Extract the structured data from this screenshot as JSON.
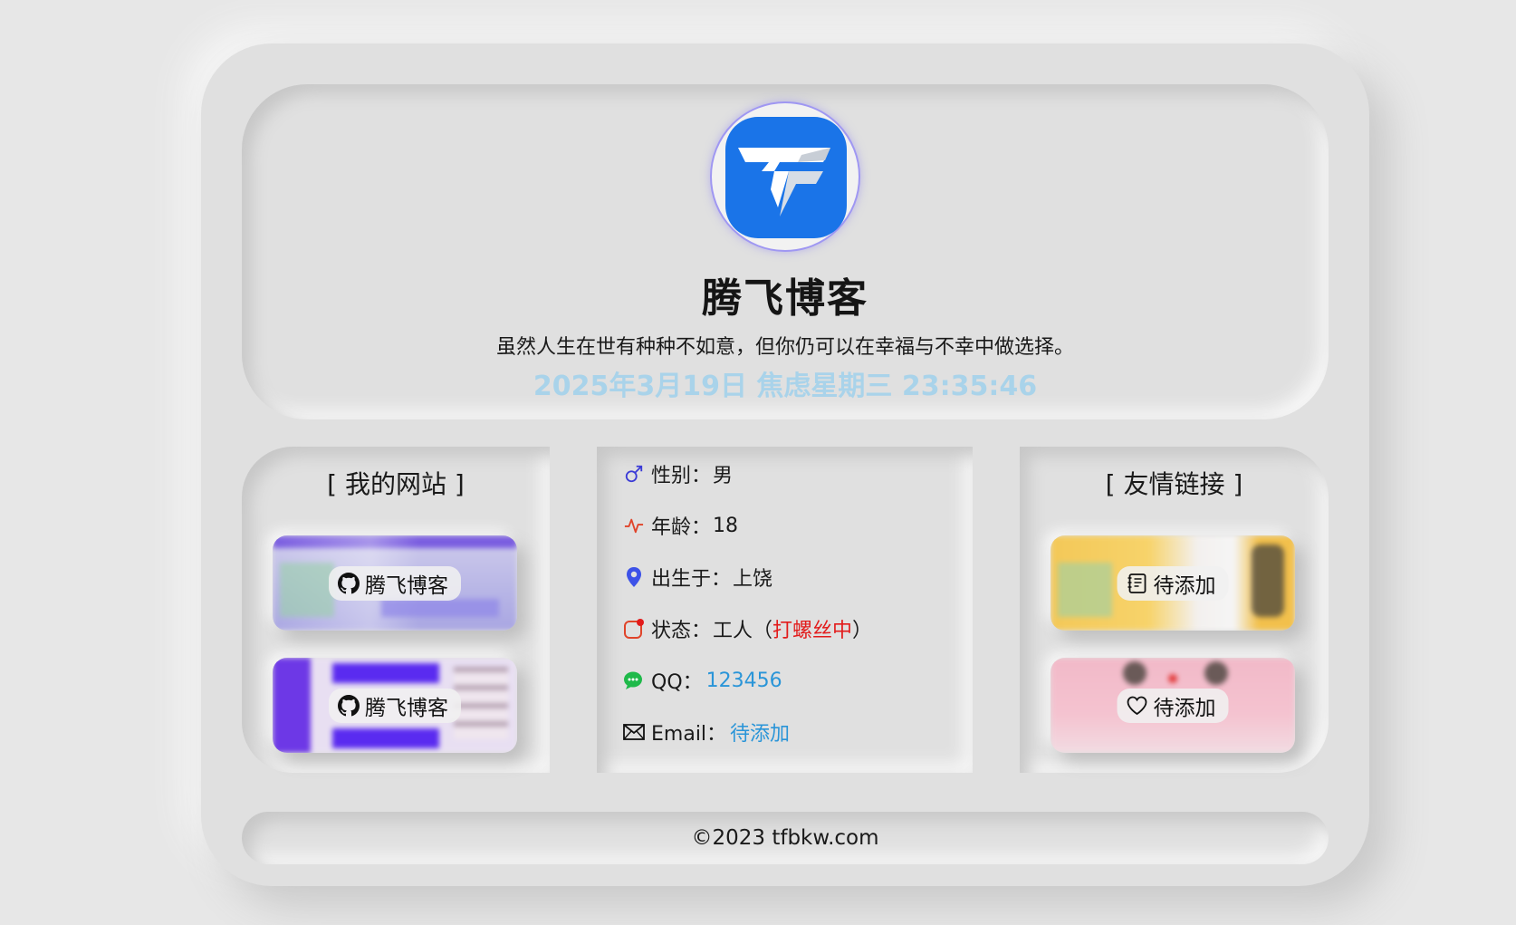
{
  "header": {
    "title": "腾飞博客",
    "motto": "虽然人生在世有种种不如意，但你仍可以在幸福与不幸中做选择。",
    "clock": "2025年3月19日 焦虑星期三 23:35:46"
  },
  "my_sites": {
    "heading": "[ 我的网站 ]",
    "items": [
      {
        "label": "腾飞博客",
        "icon": "github-icon"
      },
      {
        "label": "腾飞博客",
        "icon": "github-icon"
      }
    ]
  },
  "profile": {
    "gender_label": "性别：",
    "gender_value": "男",
    "age_label": "年龄：",
    "age_value": "18",
    "birthplace_label": "出生于：",
    "birthplace_value": "上饶",
    "status_label": "状态：",
    "status_prefix": "工人（",
    "status_highlight": "打螺丝中",
    "status_suffix": "）",
    "qq_label": "QQ：",
    "qq_value": "123456",
    "email_label": "Email：",
    "email_value": "待添加"
  },
  "friend_links": {
    "heading": "[ 友情链接 ]",
    "items": [
      {
        "label": "待添加",
        "icon": "notebook-icon"
      },
      {
        "label": "待添加",
        "icon": "heart-icon"
      }
    ]
  },
  "footer": {
    "copyright": "©2023 tfbkw.com"
  },
  "colors": {
    "accent_link": "#2a95d8",
    "status_red": "#e21b1b",
    "clock": "#a9d3ea",
    "logo_blue": "#1a74e8"
  }
}
